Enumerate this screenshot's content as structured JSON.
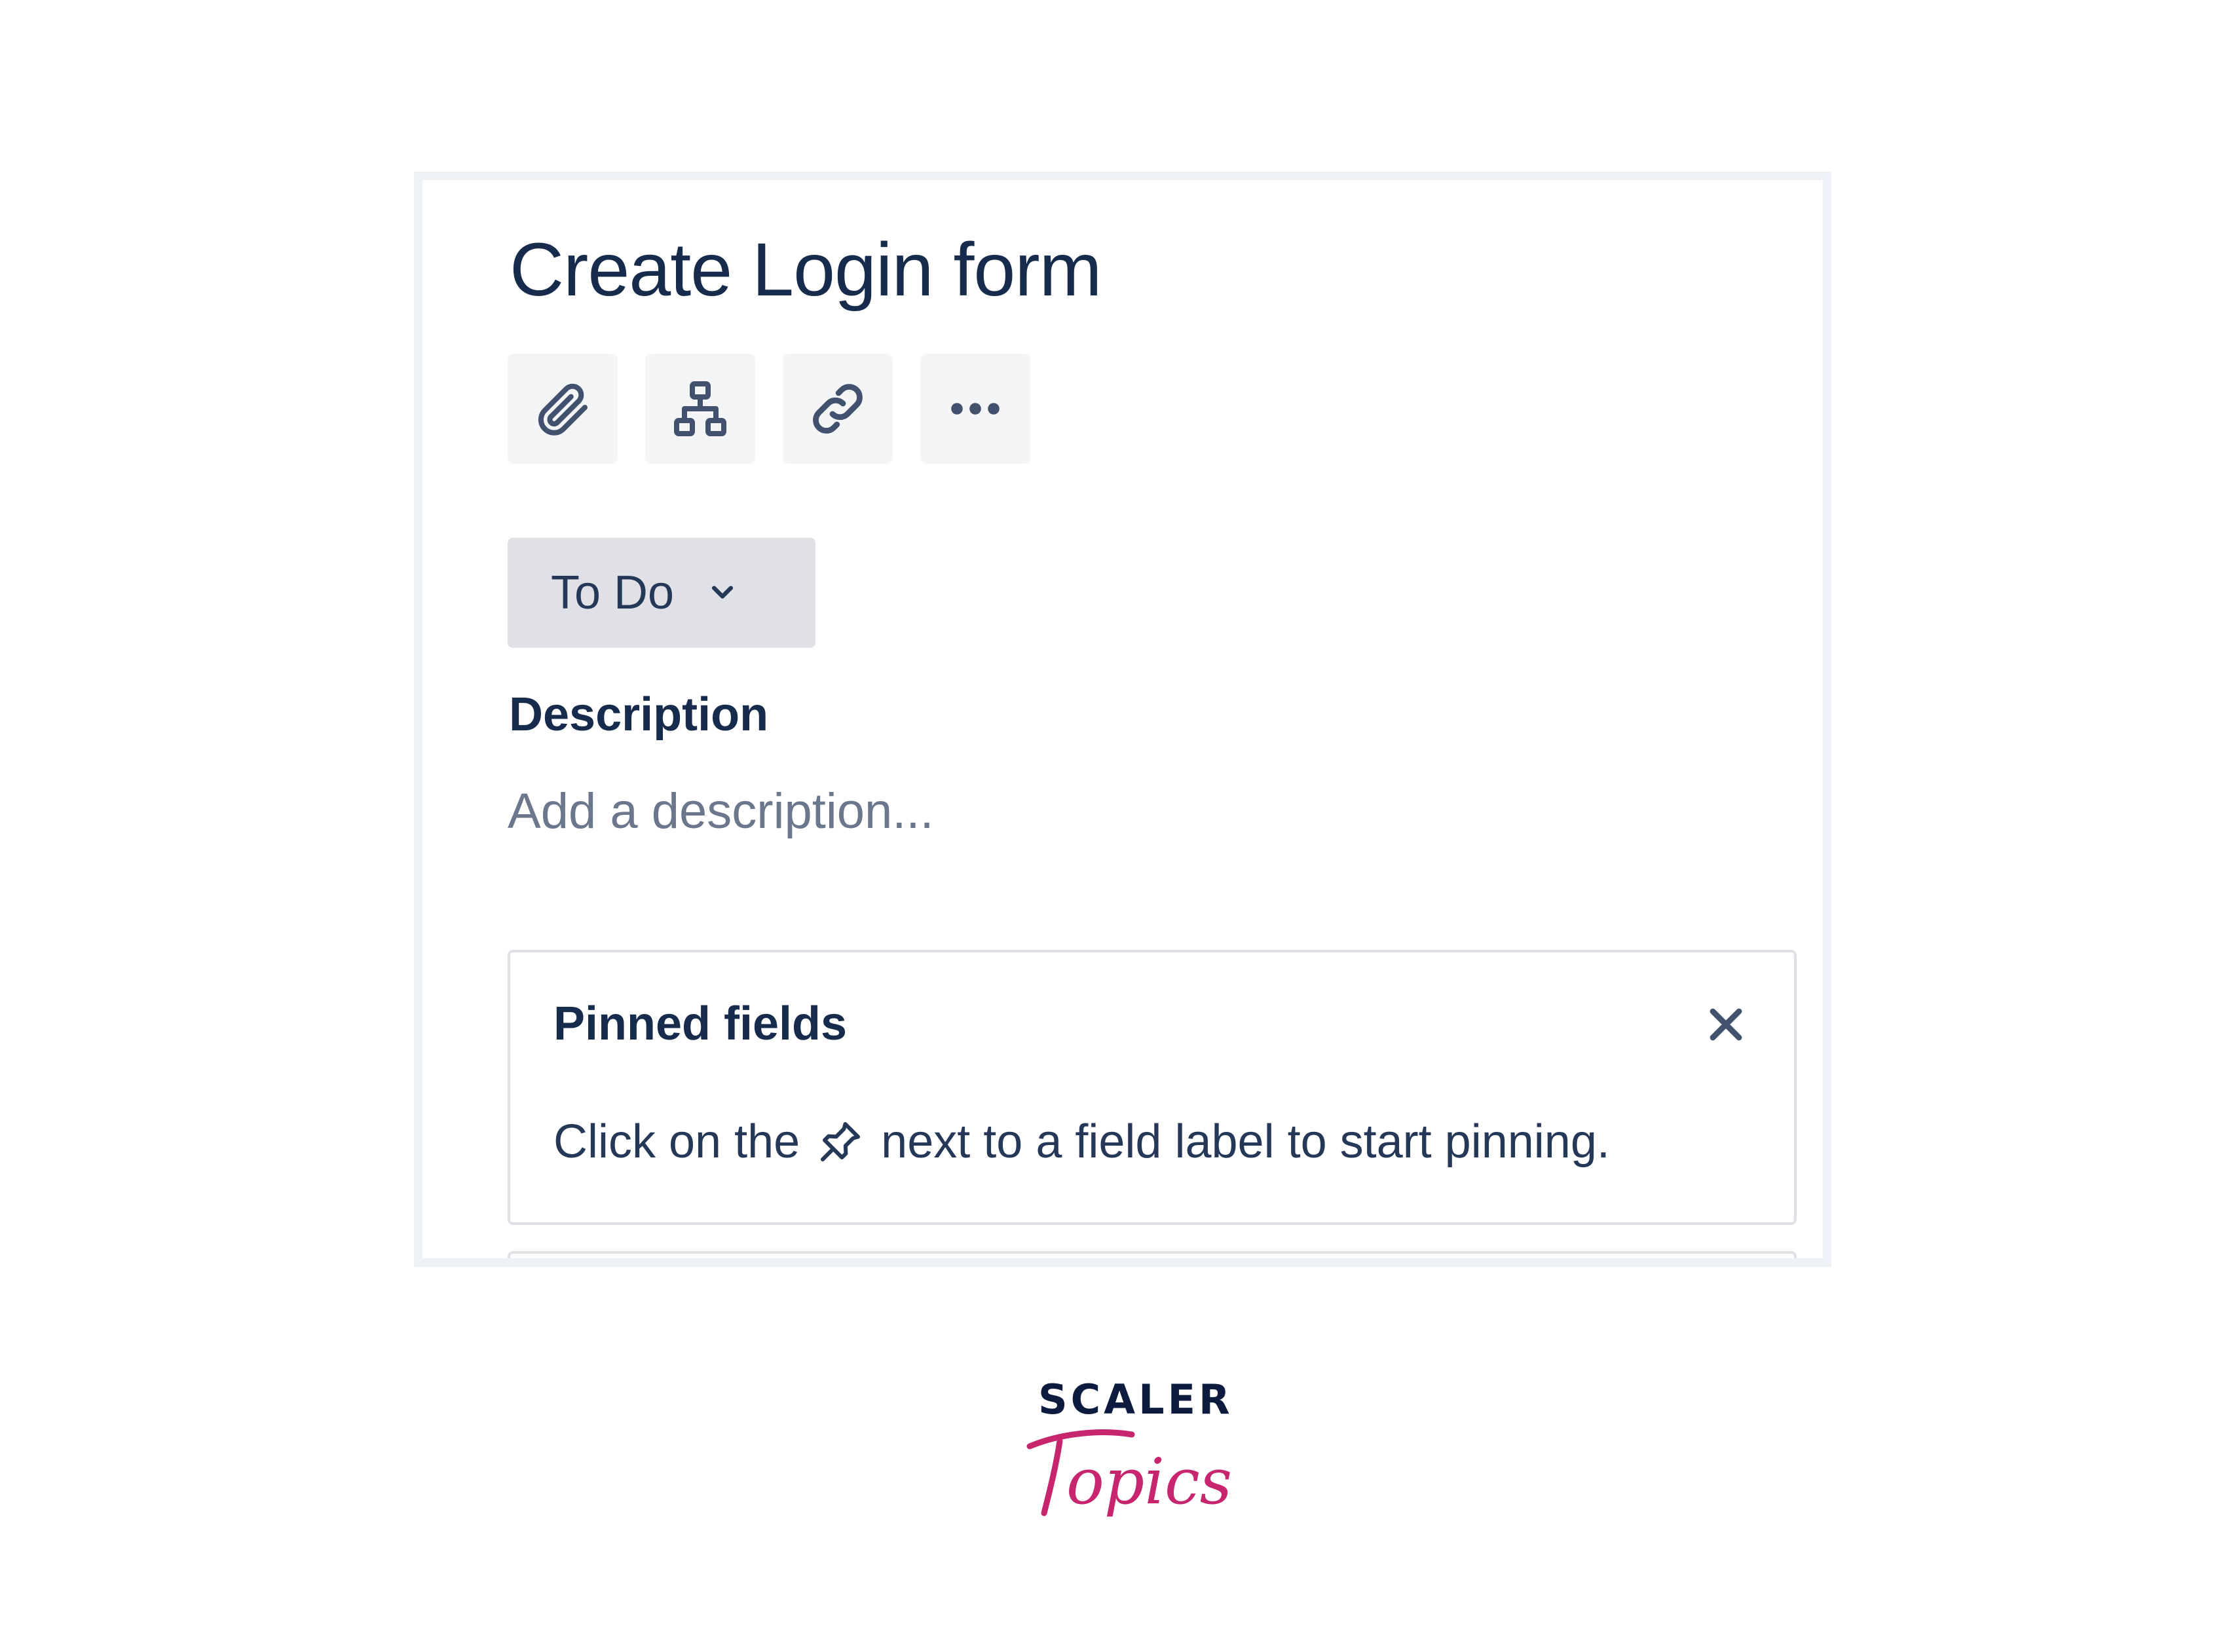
{
  "issue": {
    "title": "Create Login form"
  },
  "toolbar": {
    "buttons": [
      {
        "icon": "paperclip-icon",
        "label": ""
      },
      {
        "icon": "child-issues-icon",
        "label": ""
      },
      {
        "icon": "link-icon",
        "label": ""
      },
      {
        "icon": "more-icon",
        "label": ""
      }
    ]
  },
  "status": {
    "label": "To Do"
  },
  "description": {
    "label": "Description",
    "placeholder": "Add a description..."
  },
  "pinned_fields": {
    "title": "Pinned fields",
    "text_before": "Click on the",
    "text_after": "next to a field label to start pinning."
  },
  "branding": {
    "scaler": "SCALER",
    "topics": "Topics",
    "accent_color": "#c7256e",
    "dark_color": "#0d1b3e"
  },
  "colors": {
    "title_text": "#172b4d",
    "button_bg": "#f4f5f7",
    "status_bg": "#dfe1e6",
    "placeholder_text": "#6b778c",
    "border": "#dfe1e6"
  }
}
